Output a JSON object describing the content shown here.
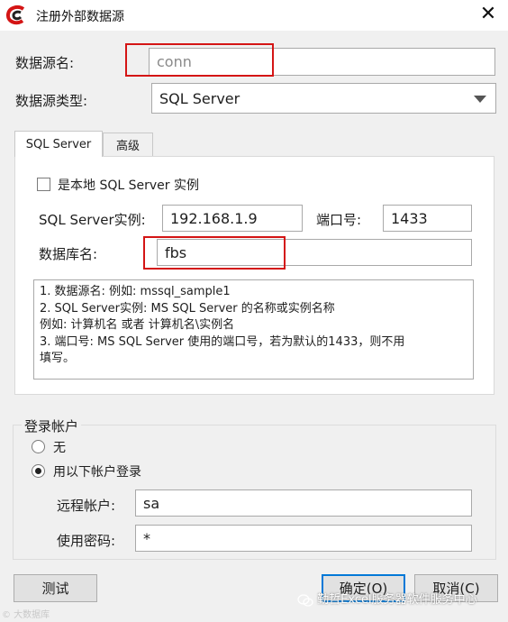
{
  "window": {
    "title": "注册外部数据源",
    "close_glyph": "✕"
  },
  "form": {
    "name_label": "数据源名:",
    "name_value": "conn",
    "type_label": "数据源类型:",
    "type_value": "SQL Server"
  },
  "tabs": [
    {
      "label": "SQL Server",
      "active": true
    },
    {
      "label": "高级",
      "active": false
    }
  ],
  "sqlserver": {
    "local_instance_label": "是本地 SQL Server 实例",
    "instance_label": "SQL Server实例:",
    "instance_value": "192.168.1.9",
    "port_label": "端口号:",
    "port_value": "1433",
    "db_label": "数据库名:",
    "db_value": "fbs",
    "help_lines": [
      "1. 数据源名:       例如: mssql_sample1",
      "2. SQL Server实例:   MS SQL Server 的名称或实例名称",
      "    例如: 计算机名 或者 计算机名\\实例名",
      "3. 端口号:   MS SQL Server 使用的端口号，若为默认的1433，则不用",
      "填写。"
    ]
  },
  "login": {
    "group_title": "登录帐户",
    "option_none": "无",
    "option_account": "用以下帐户登录",
    "selected": "account",
    "remote_user_label": "远程帐户:",
    "remote_user_value": "sa",
    "password_label": "使用密码:",
    "password_value": "*"
  },
  "buttons": {
    "test": "测试",
    "ok": "确定(O)",
    "cancel": "取消(C)"
  },
  "watermark": {
    "left": "© 大数据库",
    "right": "勤哲Excel服务器软件服务中心"
  },
  "colors": {
    "highlight_box": "#d41515",
    "focus_border": "#0078d7",
    "dialog_bg": "#f0f0f0"
  }
}
